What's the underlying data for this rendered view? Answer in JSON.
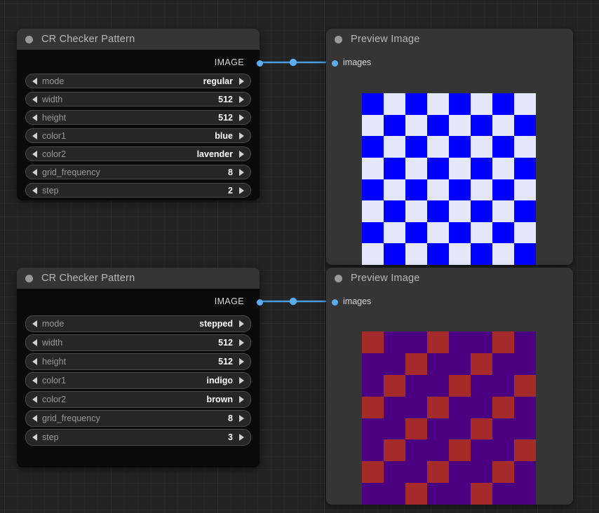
{
  "app": {
    "canvas_background": "#232323",
    "link_color": "#4a9ee0",
    "slot_color": "#5badf0"
  },
  "nodes": [
    {
      "id": "checker-1",
      "type": "CR Checker Pattern",
      "title": "CR Checker Pattern",
      "outputs": [
        {
          "label": "IMAGE",
          "type": "IMAGE"
        }
      ],
      "widgets": [
        {
          "name": "mode",
          "value": "regular"
        },
        {
          "name": "width",
          "value": "512"
        },
        {
          "name": "height",
          "value": "512"
        },
        {
          "name": "color1",
          "value": "blue"
        },
        {
          "name": "color2",
          "value": "lavender"
        },
        {
          "name": "grid_frequency",
          "value": "8"
        },
        {
          "name": "step",
          "value": "2"
        }
      ]
    },
    {
      "id": "preview-1",
      "type": "Preview Image",
      "title": "Preview Image",
      "inputs": [
        {
          "label": "images",
          "type": "IMAGE"
        }
      ],
      "image": {
        "pattern": "regular",
        "grid": 8,
        "step": 2,
        "color1": "#0000ff",
        "color1_name": "blue",
        "color2": "#e6e6fa",
        "color2_name": "lavender"
      }
    },
    {
      "id": "checker-2",
      "type": "CR Checker Pattern",
      "title": "CR Checker Pattern",
      "outputs": [
        {
          "label": "IMAGE",
          "type": "IMAGE"
        }
      ],
      "widgets": [
        {
          "name": "mode",
          "value": "stepped"
        },
        {
          "name": "width",
          "value": "512"
        },
        {
          "name": "height",
          "value": "512"
        },
        {
          "name": "color1",
          "value": "indigo"
        },
        {
          "name": "color2",
          "value": "brown"
        },
        {
          "name": "grid_frequency",
          "value": "8"
        },
        {
          "name": "step",
          "value": "3"
        }
      ]
    },
    {
      "id": "preview-2",
      "type": "Preview Image",
      "title": "Preview Image",
      "inputs": [
        {
          "label": "images",
          "type": "IMAGE"
        }
      ],
      "image": {
        "pattern": "stepped",
        "grid": 8,
        "step": 3,
        "color1": "#4b0082",
        "color1_name": "indigo",
        "color2": "#a52a2a",
        "color2_name": "brown"
      }
    }
  ],
  "links": [
    {
      "from": "checker-1",
      "from_slot": "IMAGE",
      "to": "preview-1",
      "to_slot": "images"
    },
    {
      "from": "checker-2",
      "from_slot": "IMAGE",
      "to": "preview-2",
      "to_slot": "images"
    }
  ]
}
